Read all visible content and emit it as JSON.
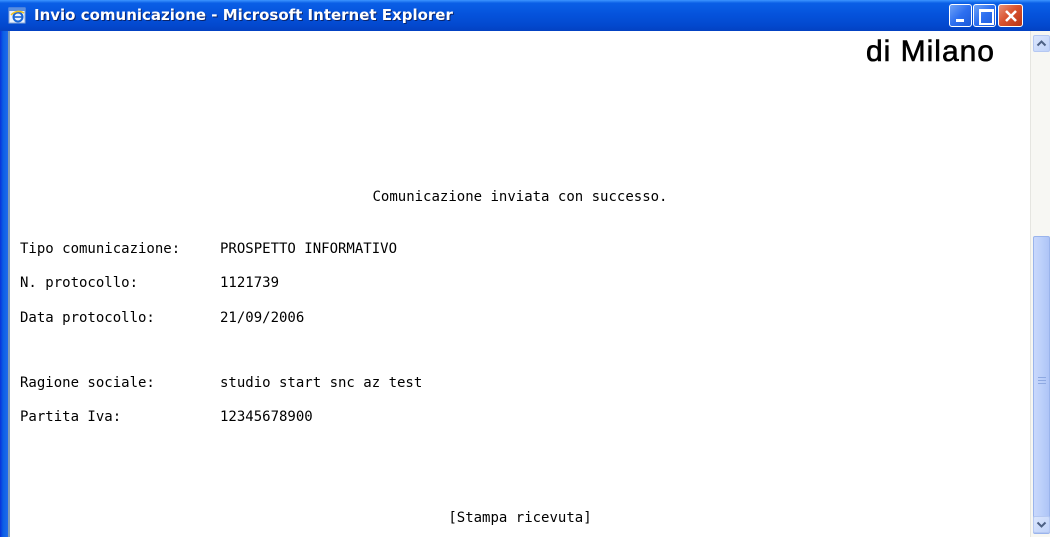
{
  "window": {
    "title": "Invio comunicazione - Microsoft Internet Explorer"
  },
  "header": {
    "logo_text": "di Milano"
  },
  "main": {
    "success_message": "Comunicazione inviata con successo.",
    "fields": [
      {
        "label": "Tipo comunicazione:",
        "value": "PROSPETTO INFORMATIVO"
      },
      {
        "label": "N. protocollo:",
        "value": "1121739"
      },
      {
        "label": "Data protocollo:",
        "value": "21/09/2006"
      },
      {
        "label": "Ragione sociale:",
        "value": "studio start snc az test"
      },
      {
        "label": "Partita Iva:",
        "value": "12345678900"
      }
    ],
    "print_link": "[Stampa ricevuta]"
  },
  "colors": {
    "titlebar": "#0553dc",
    "close_button": "#d9532f",
    "scroll_thumb": "#bcd0fa"
  },
  "icons": [
    "ie-icon",
    "minimize-icon",
    "maximize-icon",
    "close-icon",
    "scroll-up-icon",
    "scroll-down-icon"
  ]
}
